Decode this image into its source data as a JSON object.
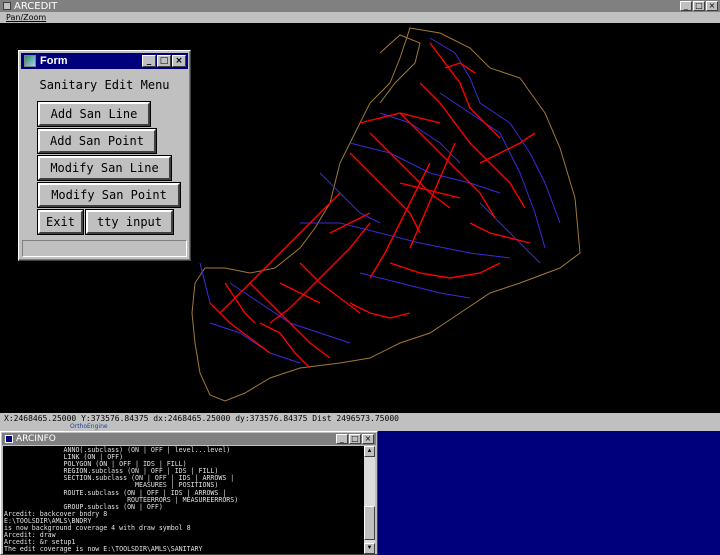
{
  "arcedit_window": {
    "title": "ARCEDIT"
  },
  "menubar": {
    "pan_zoom": "Pan/Zoom"
  },
  "status_bar": {
    "text": "X:2468465.25000 Y:373576.84375 dx:2468465.25000 dy:373576.84375 Dist 2496573.75000"
  },
  "ortho_strip": {
    "label": "OrthoEngine"
  },
  "form": {
    "title": "Form",
    "heading": "Sanitary Edit Menu",
    "buttons": {
      "add_san_line": "Add San Line",
      "add_san_point": "Add San Point",
      "modify_san_line": "Modify San Line",
      "modify_san_point": "Modify San Point",
      "exit": "Exit",
      "tty_input": "tty input"
    }
  },
  "arcinfo": {
    "title": "ARCINFO",
    "console_lines": [
      "               ANNO(.subclass) (ON | OFF | level...level)",
      "               LINK (ON | OFF)",
      "               POLYGON (ON | OFF | IDS | FILL)",
      "               REGION.subclass (ON | OFF | IDS | FILL)",
      "               SECTION.subclass (ON | OFF | IDS | ARROWS |",
      "                                 MEASURES | POSITIONS)",
      "               ROUTE.subclass (ON | OFF | IDS | ARROWS |",
      "                               ROUTEERRORS | MEASUREERRORS)",
      "               GROUP.subclass (ON | OFF)",
      "Arcedit: backcover bndry 8",
      "E:\\TOOLSDIR\\AMLS\\BNDRY",
      "is now background coverage 4 with draw symbol 8",
      "Arcedit: draw",
      "Arcedit: &r setup1",
      "The edit coverage is now E:\\TOOLSDIR\\AMLS\\SANITARY"
    ]
  },
  "window_controls": {
    "minimize": "_",
    "maximize": "□",
    "close": "×"
  },
  "colors": {
    "background": "#000000",
    "title_active": "#00007c",
    "title_inactive": "#808080",
    "face": "#c0c0c0",
    "sanitary_lines": "#ff0000",
    "other_lines": "#3a2bd8",
    "boundary": "#a0783c",
    "desktop": "#00007c"
  },
  "icons": [
    "form-app-icon",
    "arcinfo-app-icon",
    "minimize-icon",
    "maximize-icon",
    "close-icon",
    "scroll-up-arrow-icon",
    "scroll-down-arrow-icon"
  ]
}
